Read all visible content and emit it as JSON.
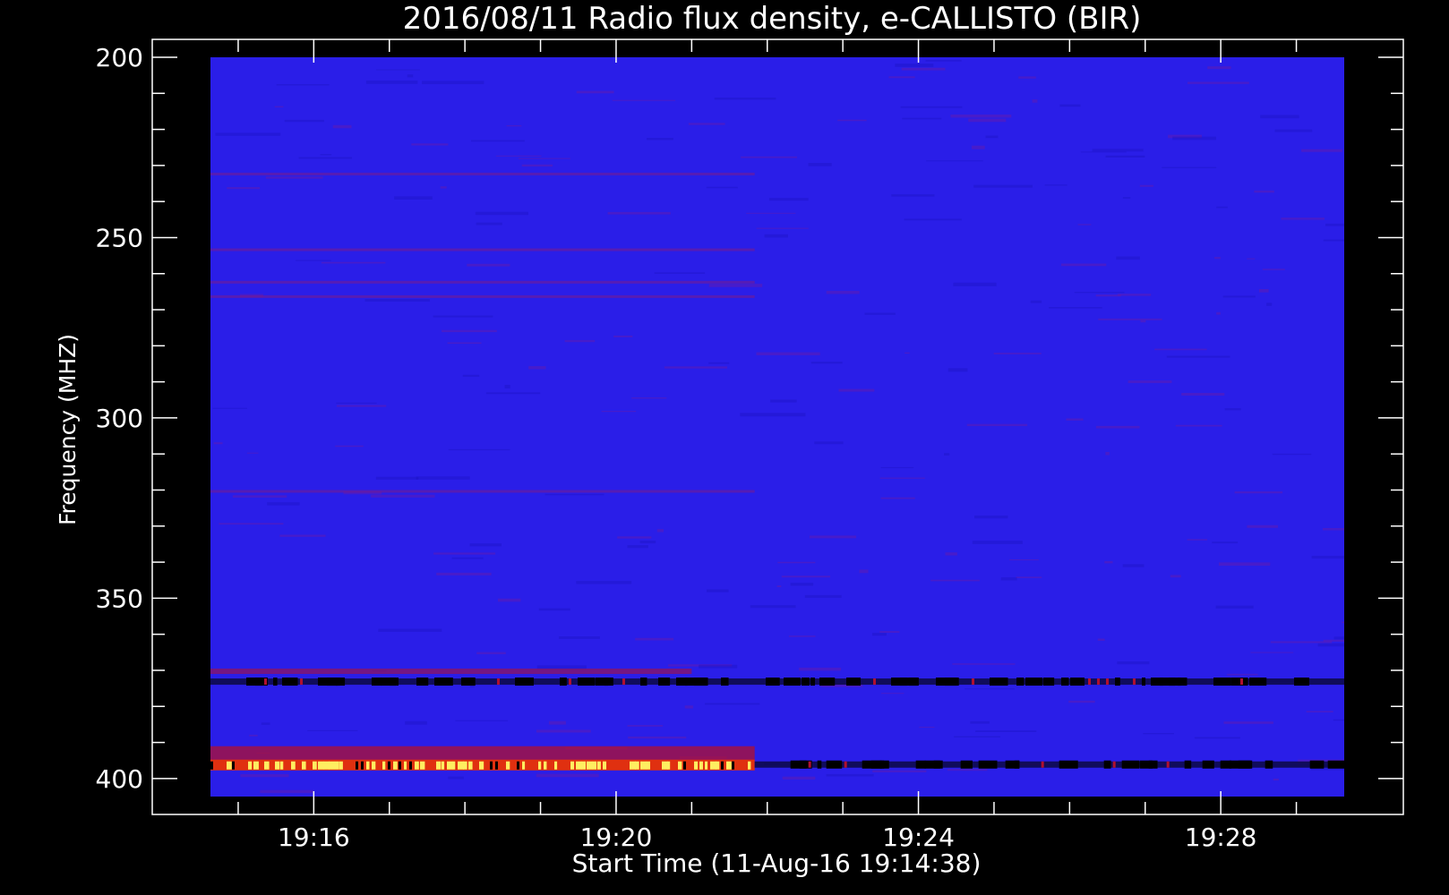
{
  "chart_data": {
    "type": "heatmap",
    "title": "2016/08/11  Radio flux density, e-CALLISTO (BIR)",
    "xlabel": "Start Time (11-Aug-16 19:14:38)",
    "ylabel": "Frequency (MHZ)",
    "x_unit": "time (HH:MM)",
    "x_range": [
      "19:14:38",
      "19:29:38"
    ],
    "x_ticks": [
      "19:16",
      "19:20",
      "19:24",
      "19:28"
    ],
    "y_range": [
      200,
      405
    ],
    "y_inverted": true,
    "y_ticks": [
      200,
      250,
      300,
      350,
      400
    ],
    "colormap": "blue-red-yellow-white",
    "colors": {
      "background": "#000000",
      "low": "#2a1ee8",
      "mid": "#b01030",
      "high": "#ffee60"
    },
    "features": [
      {
        "label": "dark band",
        "freq_mhz": 373,
        "time_start": "19:14:38",
        "time_end": "19:29:38"
      },
      {
        "label": "bright band",
        "freq_mhz": 396,
        "time_start": "19:14:38",
        "time_end": "19:21:50"
      },
      {
        "label": "dark band",
        "freq_mhz": 396,
        "time_start": "19:21:50",
        "time_end": "19:29:38"
      }
    ]
  }
}
